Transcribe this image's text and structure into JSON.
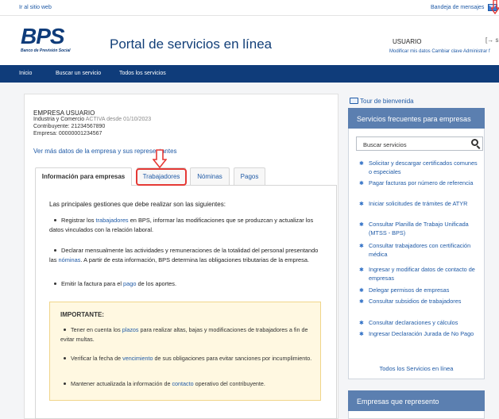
{
  "topbar": {
    "site_link": "Ir al sitio web",
    "inbox": "Bandeja de mensajes"
  },
  "header": {
    "logo": "BPS",
    "logo_sub": "Banco de Previsión Social",
    "title": "Portal de servicios en línea",
    "user": "USUARIO",
    "user_links": "Modificar mis datos  Cambiar clave  Administrar f",
    "logout": "[→ s"
  },
  "nav": {
    "items": [
      "Inicio",
      "Buscar un servicio",
      "Todos los servicios"
    ]
  },
  "company": {
    "name": "EMPRESA USUARIO",
    "type": "Industria y Comercio",
    "status": "ACTIVA desde 01/10/2023",
    "contribuyente": "Contribuyente:  21234567890",
    "empresa": "Empresa:  00000001234567",
    "more_link": "Ver más datos de la empresa y sus representantes"
  },
  "tabs": [
    "Información para empresas",
    "Trabajadores",
    "Nóminas",
    "Pagos"
  ],
  "content": {
    "intro": "Las principales gestiones que debe realizar son las siguientes:",
    "bullets": [
      {
        "a": "Registrar los ",
        "link": "trabajadores",
        "b": " en BPS, informar las modificaciones que se produzcan y actualizar los datos vinculados con la relación laboral."
      },
      {
        "a": "Declarar mensualmente las actividades y remuneraciones de la totalidad del personal presentando las ",
        "link": "nóminas",
        "b": ". A partir de esta información, BPS determina las obligaciones tributarias de la empresa."
      },
      {
        "a": "Emitir la factura para el ",
        "link": "pago",
        "b": " de los aportes."
      }
    ],
    "important_title": "IMPORTANTE:",
    "important": [
      {
        "a": "Tener en cuenta los ",
        "link": "plazos",
        "b": " para realizar altas, bajas y modificaciones de trabajadores a fin de evitar multas."
      },
      {
        "a": "Verificar la fecha de ",
        "link": "vencimiento",
        "b": " de sus obligaciones para evitar sanciones por incumplimiento."
      },
      {
        "a": "Mantener actualizada la información de ",
        "link": "contacto",
        "b": " operativo del contribuyente."
      }
    ]
  },
  "sidebar": {
    "tour": "Tour de bienvenida",
    "frequent_title": "Servicios frecuentes para empresas",
    "search_placeholder": "Buscar servicios",
    "services": [
      "Solicitar y descargar certificados comunes o especiales",
      "Pagar facturas por número de referencia",
      "Iniciar solicitudes de trámites de ATYR",
      "Consultar Planilla de Trabajo Unificada (MTSS - BPS)",
      "Consultar trabajadores con certificación médica",
      "Ingresar y modificar datos de contacto de empresas",
      "Delegar permisos de empresas",
      "Consultar subsidios de trabajadores",
      "Consultar declaraciones y cálculos",
      "Ingresar Declaración Jurada de No Pago"
    ],
    "all_services": "Todos los Servicios en línea",
    "represent_title": "Empresas que represento"
  }
}
